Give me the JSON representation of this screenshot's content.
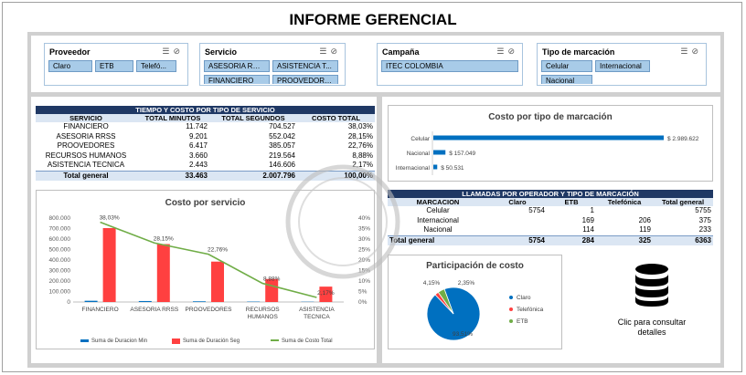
{
  "title": "INFORME GERENCIAL",
  "colors": {
    "header_navy": "#1f3864",
    "bar_blue": "#0070c0",
    "bar_red": "#ff4040",
    "line_green": "#70ad47",
    "slicer_btn": "#a8cbe8"
  },
  "slicers": [
    {
      "title": "Proveedor",
      "items": [
        "Claro",
        "ETB",
        "Telefó..."
      ]
    },
    {
      "title": "Servicio",
      "items": [
        "ASESORIA RRS...",
        "ASISTENCIA T...",
        "FINANCIERO",
        "PROOVEDORES"
      ]
    },
    {
      "title": "Campaña",
      "items": [
        "ITEC COLOMBIA"
      ]
    },
    {
      "title": "Tipo de marcación",
      "items": [
        "Celular",
        "Internacional",
        "Nacional"
      ]
    }
  ],
  "service_table": {
    "title": "TIEMPO Y COSTO POR TIPO DE SERVICIO",
    "headers": [
      "SERVICIO",
      "TOTAL MINUTOS",
      "TOTAL SEGUNDOS",
      "COSTO TOTAL"
    ],
    "rows": [
      [
        "FINANCIERO",
        "11.742",
        "704.527",
        "38,03%"
      ],
      [
        "ASESORIA RRSS",
        "9.201",
        "552.042",
        "28,15%"
      ],
      [
        "PROOVEDORES",
        "6.417",
        "385.057",
        "22,76%"
      ],
      [
        "RECURSOS HUMANOS",
        "3.660",
        "219.564",
        "8,88%"
      ],
      [
        "ASISTENCIA TECNICA",
        "2.443",
        "146.606",
        "2,17%"
      ]
    ],
    "total": [
      "Total general",
      "33.463",
      "2.007.796",
      "100,00%"
    ]
  },
  "calls_table": {
    "title": "LLAMADAS POR OPERADOR Y TIPO DE MARCACIÓN",
    "headers": [
      "MARCACION",
      "Claro",
      "ETB",
      "Telefónica",
      "Total general"
    ],
    "rows": [
      [
        "Celular",
        "5754",
        "1",
        "",
        "5755"
      ],
      [
        "Internacional",
        "",
        "169",
        "206",
        "375"
      ],
      [
        "Nacional",
        "",
        "114",
        "119",
        "233"
      ]
    ],
    "total": [
      "Total general",
      "5754",
      "284",
      "325",
      "6363"
    ]
  },
  "details_label": "Clic para consultar detalles",
  "chart_data": [
    {
      "type": "bar",
      "title": "Costo por servicio",
      "categories": [
        "FINANCIERO",
        "ASESORIA RRSS",
        "PROOVEDORES",
        "RECURSOS HUMANOS",
        "ASISTENCIA TECNICA"
      ],
      "category_lines": [
        [
          "FINANCIERO"
        ],
        [
          "ASESORIA RRSS"
        ],
        [
          "PROOVEDORES"
        ],
        [
          "RECURSOS",
          "HUMANOS"
        ],
        [
          "ASISTENCIA",
          "TECNICA"
        ]
      ],
      "series": [
        {
          "name": "Suma de Duracion Min",
          "type": "bar",
          "axis": "left",
          "values": [
            11742,
            9201,
            6417,
            3660,
            2443
          ]
        },
        {
          "name": "Suma de Duración Seg",
          "type": "bar",
          "axis": "left",
          "values": [
            704527,
            552042,
            385057,
            219564,
            146606
          ]
        },
        {
          "name": "Suma de Costo Total",
          "type": "line",
          "axis": "right",
          "values": [
            38.03,
            28.15,
            22.76,
            8.88,
            2.17
          ],
          "labels": [
            "38,03%",
            "28,15%",
            "22,76%",
            "8,88%",
            "2,17%"
          ]
        }
      ],
      "y_ticks": [
        "0",
        "100.000",
        "200.000",
        "300.000",
        "400.000",
        "500.000",
        "600.000",
        "700.000",
        "800.000"
      ],
      "ylim": [
        0,
        800000
      ],
      "y2_ticks": [
        "0%",
        "5%",
        "10%",
        "15%",
        "20%",
        "25%",
        "30%",
        "35%",
        "40%"
      ],
      "y2lim": [
        0,
        40
      ],
      "legend": "bottom"
    },
    {
      "type": "bar",
      "orientation": "horizontal",
      "title": "Costo por tipo de marcación",
      "categories": [
        "Celular",
        "Nacional",
        "Internacional"
      ],
      "values": [
        2989622,
        157049,
        50531
      ],
      "labels": [
        "$ 2.989.622",
        "$ 157.049",
        "$ 50.531"
      ]
    },
    {
      "type": "pie",
      "title": "Participación de costo",
      "categories": [
        "Claro",
        "Telefónica",
        "ETB"
      ],
      "values": [
        93.51,
        2.35,
        4.15
      ],
      "labels": [
        "93,51%",
        "2,35%",
        "4,15%"
      ],
      "colors": [
        "#0070c0",
        "#ff4040",
        "#70ad47"
      ],
      "legend": "right"
    }
  ]
}
